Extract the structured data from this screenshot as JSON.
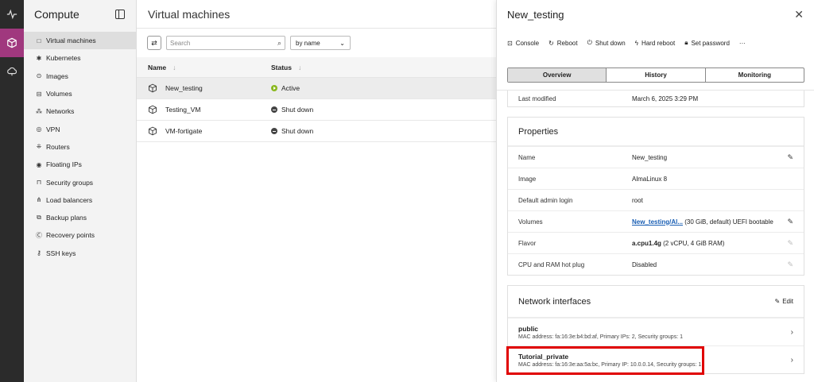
{
  "rail": {
    "items": [
      {
        "icon": "activity-icon"
      },
      {
        "icon": "cube-icon",
        "active": true
      },
      {
        "icon": "cloud-icon"
      }
    ]
  },
  "sidenav": {
    "title": "Compute",
    "items": [
      {
        "label": "Virtual machines",
        "icon": "□",
        "active": true
      },
      {
        "label": "Kubernetes",
        "icon": "✱"
      },
      {
        "label": "Images",
        "icon": "⊙"
      },
      {
        "label": "Volumes",
        "icon": "⊟"
      },
      {
        "label": "Networks",
        "icon": "⁂"
      },
      {
        "label": "VPN",
        "icon": "◎"
      },
      {
        "label": "Routers",
        "icon": "⁜"
      },
      {
        "label": "Floating IPs",
        "icon": "◉"
      },
      {
        "label": "Security groups",
        "icon": "⊓"
      },
      {
        "label": "Load balancers",
        "icon": "⋔"
      },
      {
        "label": "Backup plans",
        "icon": "⧉"
      },
      {
        "label": "Recovery points",
        "icon": "Ⓒ"
      },
      {
        "label": "SSH keys",
        "icon": "⚷"
      }
    ]
  },
  "main": {
    "title": "Virtual machines",
    "search": {
      "placeholder": "Search"
    },
    "sort": {
      "value": "by name"
    },
    "columns": {
      "name": "Name",
      "status": "Status"
    },
    "rows": [
      {
        "name": "New_testing",
        "status": "Active",
        "state": "active",
        "selected": true
      },
      {
        "name": "Testing_VM",
        "status": "Shut down",
        "state": "down"
      },
      {
        "name": "VM-fortigate",
        "status": "Shut down",
        "state": "down"
      }
    ]
  },
  "panel": {
    "title": "New_testing",
    "actions": {
      "console": "Console",
      "reboot": "Reboot",
      "shutdown": "Shut down",
      "hard_reboot": "Hard reboot",
      "set_password": "Set password",
      "more": "···"
    },
    "tabs": {
      "overview": "Overview",
      "history": "History",
      "monitoring": "Monitoring"
    },
    "last_modified": {
      "label": "Last modified",
      "value": "March 6, 2025 3:29 PM"
    },
    "properties": {
      "title": "Properties",
      "name": {
        "label": "Name",
        "value": "New_testing"
      },
      "image": {
        "label": "Image",
        "value": "AlmaLinux 8"
      },
      "admin": {
        "label": "Default admin login",
        "value": "root"
      },
      "volumes": {
        "label": "Volumes",
        "link": "New_testing/Al...",
        "value": " (30 GiB, default) UEFI bootable"
      },
      "flavor": {
        "label": "Flavor",
        "bold": "a.cpu1.4g",
        "value": " (2 vCPU, 4 GiB RAM)"
      },
      "hotplug": {
        "label": "CPU and RAM hot plug",
        "value": "Disabled"
      }
    },
    "network": {
      "title": "Network interfaces",
      "edit": "Edit",
      "interfaces": [
        {
          "name": "public",
          "meta": "MAC address: fa:16:3e:b4:bd:af, Primary IPs: 2, Security groups: 1"
        },
        {
          "name": "Tutorial_private",
          "meta": "MAC address: fa:16:3e:aa:5a:bc, Primary IP: 10.0.0.14, Security groups: 1"
        }
      ]
    }
  },
  "colors": {
    "rail_active": "#a0387e",
    "highlight": "#e00000",
    "link": "#1a5fb4",
    "status_active": "#8ab81f"
  }
}
